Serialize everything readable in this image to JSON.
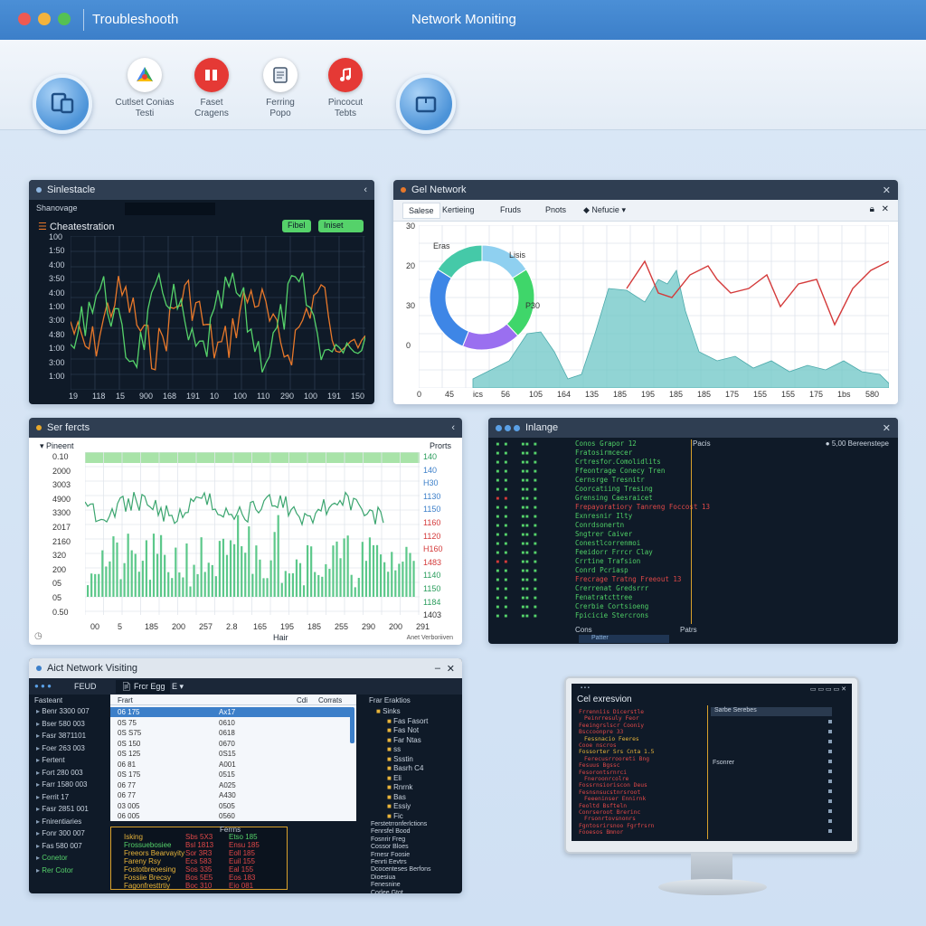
{
  "window": {
    "title": "Troubleshooth",
    "center_title": "Network Moniting"
  },
  "toolbar": {
    "apps": [
      {
        "line1": "Cutlset Conias",
        "line2": "Testi"
      },
      {
        "line1": "Faset",
        "line2": "Cragens"
      },
      {
        "line1": "Ferring",
        "line2": "Popo"
      },
      {
        "line1": "Pincocut",
        "line2": "Tebts"
      }
    ]
  },
  "colors": {
    "accent": "#3c7fc9",
    "green": "#55d26a",
    "orange": "#e8782a",
    "red": "#d43a3a",
    "teal": "#6cc5c6"
  },
  "panel1": {
    "title": "Sinlestacle",
    "subtitle": "Shanovage",
    "chart_title": "Cheatestration",
    "btn1": "Fibel",
    "btn2": "Iniset",
    "y_ticks": [
      "100",
      "1:50",
      "4:00",
      "3:50",
      "4:00",
      "1:00",
      "3:00",
      "4:80",
      "1:00",
      "3:00",
      "1:00"
    ],
    "x_ticks": [
      "19",
      "118",
      "15",
      "900",
      "168",
      "191",
      "10",
      "100",
      "110",
      "290",
      "100",
      "191",
      "150"
    ]
  },
  "panel2": {
    "title": "Gel Network",
    "tabs": [
      "Salese",
      "Kertieing",
      "Fruds",
      "Pnots",
      "Nefucie"
    ],
    "legend": [
      "Eras",
      "Lisis",
      "P30"
    ],
    "y_ticks": [
      "30",
      "20",
      "30",
      "0"
    ],
    "x_ticks": [
      "0",
      "45",
      "ics",
      "56",
      "105",
      "164",
      "135",
      "185",
      "195",
      "185",
      "185",
      "175",
      "155",
      "155",
      "175",
      "1bs",
      "580"
    ]
  },
  "panel3": {
    "title": "Ser fercts",
    "left_label": "Pineent",
    "right_label": "Prorts",
    "y_ticks": [
      "0.10",
      "2000",
      "3003",
      "4900",
      "3300",
      "2017",
      "2160",
      "320",
      "200",
      "05",
      "05",
      "0.50"
    ],
    "right_ticks": [
      "140",
      "140",
      "H30",
      "1130",
      "1150",
      "1160",
      "1120",
      "H160",
      "1483",
      "1140",
      "1150",
      "1184",
      "1403"
    ],
    "x_ticks": [
      "00",
      "5",
      "185",
      "200",
      "257",
      "2.8",
      "165",
      "195",
      "185",
      "255",
      "290",
      "200",
      "291"
    ],
    "xlabel": "Hair",
    "footer": "Anet Verboriiven"
  },
  "panel4": {
    "title": "Inlange",
    "header_right": "Pacis",
    "header_badge": "● 5,00 Bereenstepe",
    "footer_left": "Cons",
    "footer_right": "Patrs",
    "status": "Patter",
    "lines": [
      "Conos Grapor 12",
      "Fratosirmcecer",
      "Crtresfor.Comolidlits",
      "Ffeontrage Conecy Tren",
      "Cernsrge Tresnitr",
      "Coorcatiing Tresing",
      "Grensing Caesraicet",
      "Frepayoratiory Tanreng Foccost 13",
      "Exnresnir Ilty",
      "Conrdsonertn",
      "Sngtrer Caiver",
      "Conestlcorrenmoi",
      "Feeidorr Frrcr Clay",
      "Crrtine Trafsion",
      "Conrd Pcriasp",
      "Frecrage Tratng Freeout 13",
      "Crerrenat Gredsrrr",
      "Fenatratcttree",
      "Crerbie Cortsioeng",
      "Fpicicie Stercrons"
    ]
  },
  "panel5": {
    "title": "Aict Network Visiting",
    "tab1": "FEUD",
    "tab2": "Frcr Egg",
    "tab3": "E",
    "side_head": "Fasteant",
    "side_items": [
      "Benr 3300 007",
      "Bser 580 003",
      "Fasr 3871101",
      "Foer 263 003",
      "Fertent",
      "Fort 280 003",
      "Farr 1580 003",
      "Ferrit 17",
      "Fasr 2851 001",
      "Fnirentiaries",
      "Fonr 300 007",
      "Fas 580 007",
      "Conetor",
      "Rer Cotor"
    ],
    "table_cols": [
      "Frart",
      "Cdi",
      "Corrats"
    ],
    "table_rows": [
      [
        "06 175",
        "Ax17"
      ],
      [
        "0S 75",
        "0610"
      ],
      [
        "0S S75",
        "0618"
      ],
      [
        "0S 150",
        "0670"
      ],
      [
        "0S 125",
        "0S15"
      ],
      [
        "06 81",
        "A001"
      ],
      [
        "0S 175",
        "0515"
      ],
      [
        "06 77",
        "A025"
      ],
      [
        "06 77",
        "A430"
      ],
      [
        "03 005",
        "0505"
      ],
      [
        "06 005",
        "0560"
      ]
    ],
    "tree_head": "Frar Eraktios",
    "tree_items": [
      "Sinks",
      "Fas Fasort",
      "Fas Not",
      "Far Ntas",
      "ss",
      "Ssstin",
      "Basrh C4",
      "Eli",
      "Rnrnk",
      "Bas",
      "Essiy",
      "Fic"
    ],
    "bottom_head": "Ferrns",
    "bottom_rows": [
      [
        "Isking",
        "Sbs 5X3",
        "Etso 185"
      ],
      [
        "Frossuebosiee",
        "Bsl 1813",
        "Ensu 185"
      ],
      [
        "Freeors Bearvayity",
        "Sor 3R3",
        "Eoll 185"
      ],
      [
        "Fareny Rsy",
        "Ecs 583",
        "Euil 155"
      ],
      [
        "Fostotbreoesing",
        "Sos 335",
        "Eal 155"
      ],
      [
        "Fossiie Brecsy",
        "Bos 5E5",
        "Eos 183"
      ],
      [
        "Fagonfresttrtiy",
        "Boc 310",
        "Eio 081"
      ]
    ],
    "right_list": [
      "Ferstetrronferlctions",
      "Fenrsfel Bood",
      "Fosnrir Freg",
      "Cossor Bloes",
      "Frnesr Foosie",
      "Fenrti Eevtrs",
      "Dcocenteses Berfons",
      "Dioesiua",
      "Fenesnine",
      "Corlee Gtgt"
    ]
  },
  "monitor": {
    "title": "Cel exresvion",
    "lines": [
      "Frrenniis Dicerstle",
      "Peinrresuly Feor",
      "Feeingrslscr Cooniy",
      "Bsccoonpre 33",
      "Fessnacio Feeres",
      "Cooe nscros",
      "Fossorter Srs Cnta 1.5",
      "Ferecusrrooreti Bng",
      "Fesuus Bgssc",
      "Fesorontsrnrci",
      "Fneroonrcolre",
      "Fossrnsioriscon Deus",
      "Fesnsnsucstnrsroot",
      "Feeeninser Ennirnk",
      "Feoltd Bsfteln",
      "Conrseroot Brerinc",
      "Frsonrtovsnonrs",
      "Fgntosrirsnoo Fgrfrsrn",
      "Fooesos Bmnor"
    ],
    "right_header": "Sarbe Serebes",
    "right_item": "Fsonrer"
  }
}
